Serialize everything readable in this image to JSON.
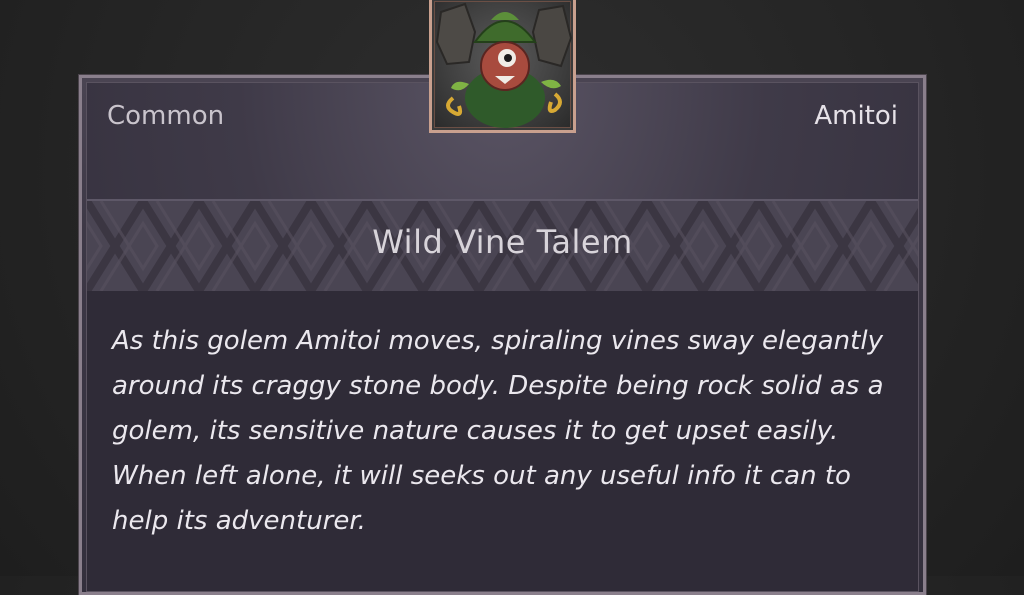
{
  "card": {
    "rarity": "Common",
    "category": "Amitoi",
    "title": "Wild Vine Talem",
    "description": "As this golem Amitoi moves, spiraling vines sway elegantly around its craggy stone body. Despite being rock solid as a golem, its sensitive nature causes it to get upset easily. When left alone, it will seeks out any useful info it can to help its adventurer."
  },
  "portrait": {
    "icon": "golem-amitoi-portrait",
    "accent_color": "#c9a08e"
  },
  "colors": {
    "background": "#262626",
    "panel": "#3d3846",
    "title_band": "#4a4553",
    "text": "#ebe8ee"
  }
}
